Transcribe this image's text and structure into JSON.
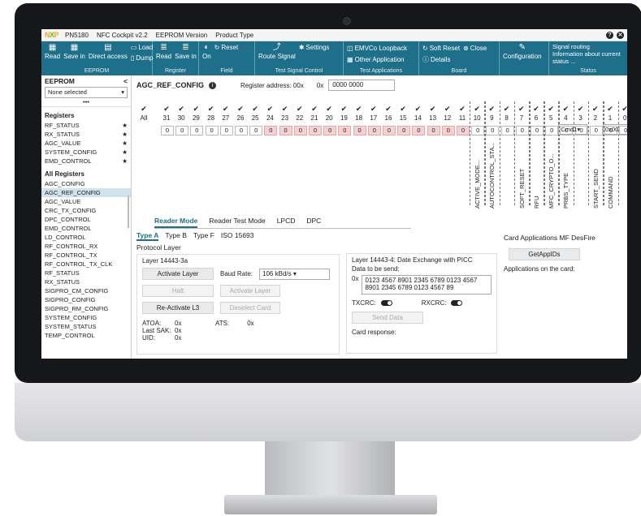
{
  "titlebar": {
    "product": "PN5180",
    "cockpit": "NFC Cockpit v2.2",
    "eeprom": "EEPROM Version",
    "ptype": "Product Type",
    "help": "?",
    "close": "✕"
  },
  "ribbon": {
    "eeprom": {
      "name": "EEPROM",
      "read": "Read",
      "save": "Save in",
      "direct": "Direct access",
      "load": "Load",
      "dump": "Dump"
    },
    "register": {
      "name": "Register",
      "read": "Read",
      "save": "Save in"
    },
    "field": {
      "name": "Field",
      "on": "On",
      "reset": "Reset"
    },
    "test": {
      "name": "Test Signal Control",
      "route": "Route Signal",
      "settings": "Settings"
    },
    "apps": {
      "name": "Test Applications",
      "emvco": "EMVCo Loopback",
      "other": "Other Application"
    },
    "board": {
      "name": "Board",
      "soft": "Soft Reset",
      "close": "Close",
      "details": "Details"
    },
    "config": {
      "label": "Configuration"
    },
    "status": {
      "name": "Status",
      "line1": "Signal routing",
      "line2": "Information about current",
      "line3": "status ..."
    }
  },
  "sidebar": {
    "title": "EEPROM",
    "collapse": "<",
    "selected": "None selected",
    "dots": "•••",
    "registers_title": "Registers",
    "favorites": [
      "RF_STATUS",
      "RX_STATUS",
      "AGC_VALUE",
      "SYSTEM_CONFIG",
      "EMD_CONTROL"
    ],
    "star": "★",
    "all_title": "All Registers",
    "all": [
      "AGC_CONFIG",
      "AGC_REF_CONFIG",
      "AGC_VALUE",
      "CRC_TX_CONFIG",
      "DPC_CONTROL",
      "EMD_CONTROL",
      "LD_CONTROL",
      "RF_CONTROL_RX",
      "RF_CONTROL_TX",
      "RF_CONTROL_TX_CLK",
      "RF_STATUS",
      "RX_STATUS",
      "SIGPRO_CM_CONFIG",
      "SIGPRO_CONFIG",
      "SIGPRO_RM_CONFIG",
      "SYSTEM_CONFIG",
      "SYSTEM_STATUS",
      "TEMP_CONTROL"
    ]
  },
  "register": {
    "name": "AGC_REF_CONFIG",
    "info": "i",
    "address_label": "Register address: 00x",
    "hex_prefix": "0x",
    "value": "0000 0000",
    "all_label": "All",
    "check": "✔",
    "bit_numbers": [
      "31",
      "30",
      "29",
      "28",
      "27",
      "26",
      "25",
      "24",
      "23",
      "22",
      "21",
      "20",
      "19",
      "18",
      "17",
      "16",
      "15",
      "14",
      "13",
      "12",
      "11",
      "10",
      "9",
      "8",
      "7",
      "6",
      "5",
      "4",
      "3",
      "2",
      "1",
      "0"
    ],
    "bit_values": [
      "0",
      "0",
      "0",
      "0",
      "0",
      "0",
      "0",
      "0",
      "0",
      "0",
      "0",
      "0",
      "0",
      "0",
      "0",
      "0",
      "0",
      "0",
      "0",
      "0",
      "0",
      "0",
      "0",
      "0",
      "0",
      "0",
      "0",
      "0",
      "0",
      "0",
      "0",
      "0"
    ],
    "field_labels": [
      "ACTIVE_MODE...",
      "AUTOCONTROL_STA...",
      "SOFT_RESET",
      "RFU",
      "MFC_CRYPTO_O...",
      "PRBS_TYPE",
      "START_SEND",
      "COMMAND"
    ],
    "cmd_select": "Cmd1▾",
    "cmd_value": "0x00"
  },
  "tabs": [
    "Reader Mode",
    "Reader Test Mode",
    "LPCD",
    "DPC"
  ],
  "subtabs": [
    "Type A",
    "Type B",
    "Type F",
    "ISO 15693"
  ],
  "protocol": {
    "title": "Protocol Layer",
    "layer3": "Layer 14443-3a",
    "activate": "Activate Layer",
    "baud_label": "Baud Rate:",
    "baud_value": "106 kBd/s ▾",
    "halt": "Halt",
    "activate2": "Activate Layer",
    "reactivate": "Re-Activate L3",
    "deselect": "Deselect Card",
    "atoa_label": "ATOA:",
    "atoa_val": "0x",
    "sak_label": "Last SAK:",
    "sak_val": "0x",
    "uid_label": "UID:",
    "uid_val": "0x",
    "ats_label": "ATS:",
    "ats_val": "0x",
    "layer4": "Layer 14443-4: Date Exchange with PICC",
    "data_label": "Data to be send:",
    "data_prefix": "0x",
    "data_line1": "0123 4567 8901 2345 6789 0123 4567",
    "data_line2": "8901 2345 6789 0123 4567 89",
    "txcrc": "TXCRC:",
    "rxcrc": "RXCRC:",
    "send": "Send Data",
    "response": "Card response:"
  },
  "apps": {
    "title": "Card Applications MF DesFire",
    "get": "GetAppIDs",
    "on_card": "Applications on the card:"
  }
}
